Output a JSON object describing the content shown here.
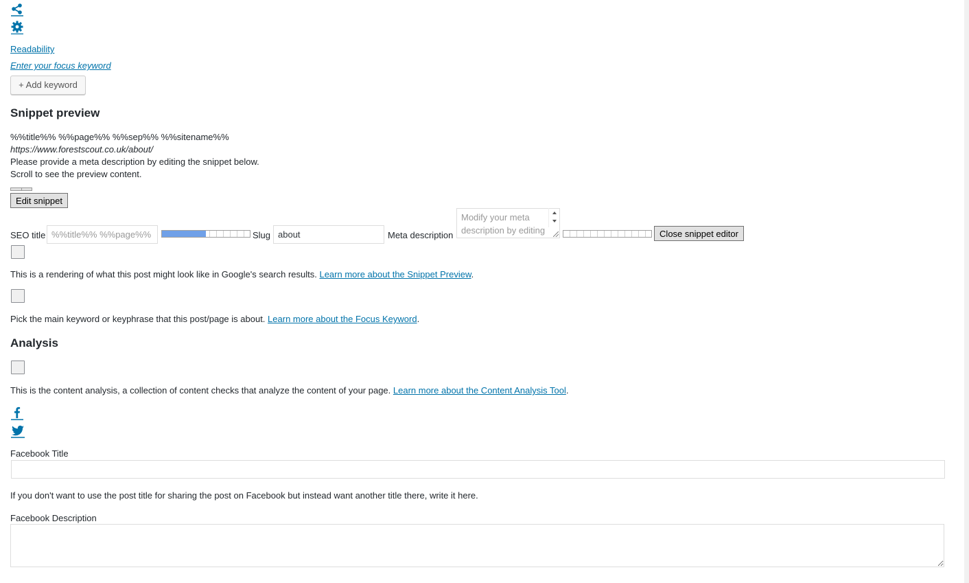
{
  "icons": {
    "share": "share-icon",
    "settings": "gear-icon",
    "facebook": "facebook-icon",
    "twitter": "twitter-icon"
  },
  "links": {
    "readability": "Readability",
    "focus_keyword": "Enter your focus keyword"
  },
  "buttons": {
    "add_keyword": "+ Add keyword",
    "edit_snippet": "Edit snippet",
    "close_snippet_editor": "Close snippet editor"
  },
  "snippet": {
    "heading": "Snippet preview",
    "title_line": "%%title%% %%page%% %%sep%% %%sitename%%",
    "url": "https://www.forestscout.co.uk/about/",
    "desc_line1": "Please provide a meta description by editing the snippet below.",
    "desc_line2": "Scroll to see the preview content."
  },
  "editor": {
    "seo_title_label": "SEO title",
    "seo_title_placeholder": "%%title%% %%page%% %%sep%% %%sitename%%",
    "seo_title_progress": 0.5,
    "slug_label": "Slug",
    "slug_value": "about",
    "meta_label": "Meta description",
    "meta_placeholder": "Modify your meta description by editing it right here",
    "meta_progress": 0
  },
  "help": {
    "snippet_text": "This is a rendering of what this post might look like in Google's search results. ",
    "snippet_link": "Learn more about the Snippet Preview",
    "focus_text": "Pick the main keyword or keyphrase that this post/page is about. ",
    "focus_link": "Learn more about the Focus Keyword",
    "analysis_text": "This is the content analysis, a collection of content checks that analyze the content of your page. ",
    "analysis_link": "Learn more about the Content Analysis Tool",
    "period": "."
  },
  "analysis": {
    "heading": "Analysis"
  },
  "social": {
    "fb_title_label": "Facebook Title",
    "fb_title_value": "",
    "fb_title_help": "If you don't want to use the post title for sharing the post on Facebook but instead want another title there, write it here.",
    "fb_desc_label": "Facebook Description",
    "fb_desc_value": ""
  },
  "colors": {
    "accent": "#0073aa",
    "progress_fill": "#6fa0e8"
  }
}
